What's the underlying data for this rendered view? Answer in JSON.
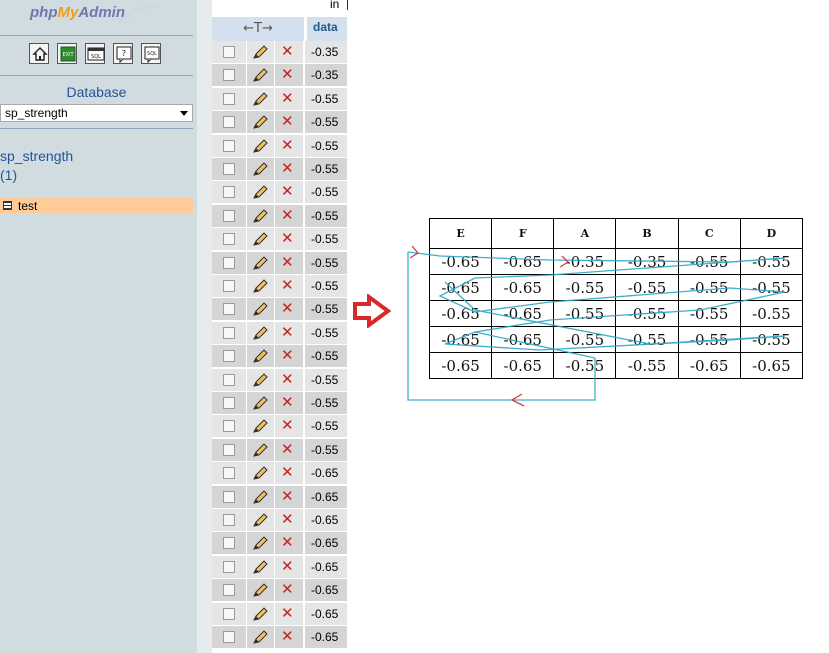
{
  "nav": {
    "logo": {
      "php": "php",
      "my": "My",
      "admin": "Admin"
    },
    "icons": [
      "home-icon",
      "exit-icon",
      "sql-icon",
      "help-icon",
      "docs-icon"
    ],
    "icon_labels": {
      "exit": "EXIT",
      "sql": "SQL"
    },
    "database_label": "Database",
    "database_selected": "sp_strength",
    "db_name": "sp_strength",
    "db_table_count": "(1)",
    "tables": [
      {
        "label": "test"
      }
    ]
  },
  "top_fragment": "in",
  "grid": {
    "header_arrows": "←T→",
    "header_column": "data",
    "rows": [
      {
        "value": "-0.35"
      },
      {
        "value": "-0.35"
      },
      {
        "value": "-0.55"
      },
      {
        "value": "-0.55"
      },
      {
        "value": "-0.55"
      },
      {
        "value": "-0.55"
      },
      {
        "value": "-0.55"
      },
      {
        "value": "-0.55"
      },
      {
        "value": "-0.55"
      },
      {
        "value": "-0.55"
      },
      {
        "value": "-0.55"
      },
      {
        "value": "-0.55"
      },
      {
        "value": "-0.55"
      },
      {
        "value": "-0.55"
      },
      {
        "value": "-0.55"
      },
      {
        "value": "-0.55"
      },
      {
        "value": "-0.55"
      },
      {
        "value": "-0.55"
      },
      {
        "value": "-0.65"
      },
      {
        "value": "-0.65"
      },
      {
        "value": "-0.65"
      },
      {
        "value": "-0.65"
      },
      {
        "value": "-0.65"
      },
      {
        "value": "-0.65"
      },
      {
        "value": "-0.65"
      },
      {
        "value": "-0.65"
      }
    ]
  },
  "matrix": {
    "headers": [
      "E",
      "F",
      "A",
      "B",
      "C",
      "D"
    ],
    "rows": [
      [
        "-0.65",
        "-0.65",
        "-0.35",
        "-0.35",
        "-0.55",
        "-0.55"
      ],
      [
        "-0.65",
        "-0.65",
        "-0.55",
        "-0.55",
        "-0.55",
        "-0.55"
      ],
      [
        "-0.65",
        "-0.65",
        "-0.55",
        "-0.55",
        "-0.55",
        "-0.55"
      ],
      [
        "-0.65",
        "-0.65",
        "-0.55",
        "-0.55",
        "-0.55",
        "-0.55"
      ],
      [
        "-0.65",
        "-0.65",
        "-0.55",
        "-0.55",
        "-0.65",
        "-0.65"
      ]
    ]
  },
  "colors": {
    "nav_bg": "#d0dce0",
    "link_blue": "#24539b",
    "selected_table_bg": "#ffcc99",
    "delete_red": "#c62222",
    "arrow_red": "#d62a2a",
    "scribble_cyan": "#2aa7c6"
  }
}
